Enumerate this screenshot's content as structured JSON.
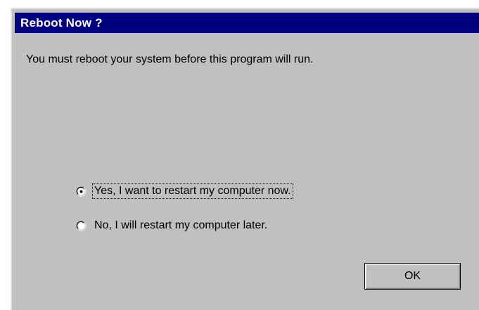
{
  "window": {
    "title": "Reboot Now ?"
  },
  "message": "You must reboot your system before this program will run.",
  "options": [
    {
      "label": "Yes, I want to restart my computer now.",
      "selected": true,
      "focused": true
    },
    {
      "label": "No, I will restart my computer later.",
      "selected": false,
      "focused": false
    }
  ],
  "buttons": {
    "ok_label": "OK"
  },
  "colors": {
    "titlebar": "#000080",
    "dialog_face": "#c0c0c0",
    "title_text": "#ffffff"
  },
  "icons": {
    "radio_selected": "radio-selected-icon",
    "radio_unselected": "radio-unselected-icon"
  }
}
